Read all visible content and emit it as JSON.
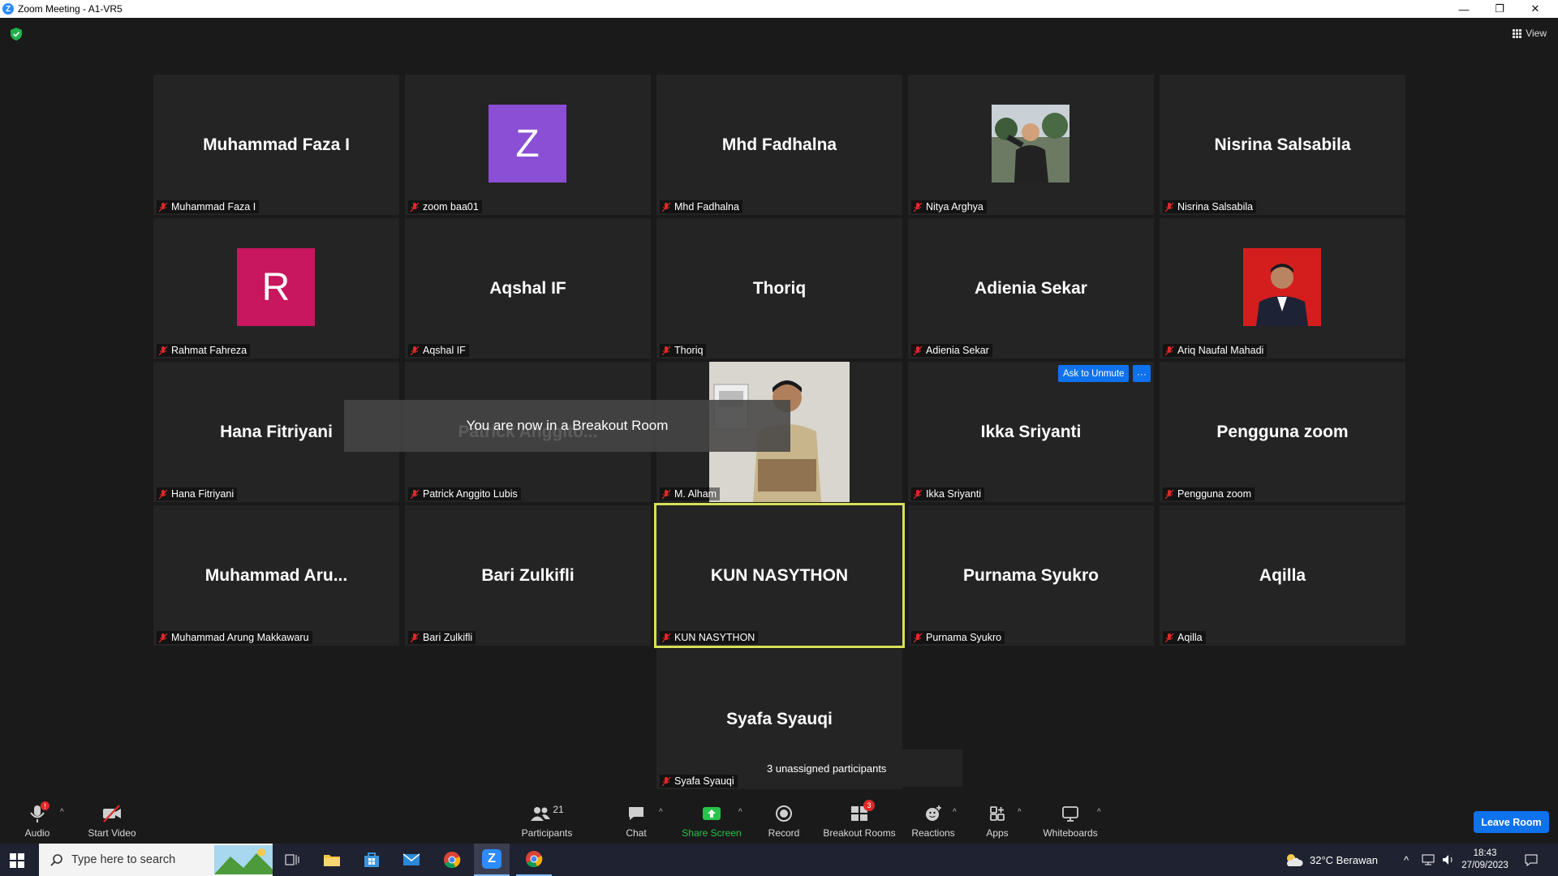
{
  "window": {
    "title": "Zoom Meeting - A1-VR5"
  },
  "view_label": "View",
  "tiles": [
    {
      "name": "Muhammad Faza I",
      "label": "Muhammad Faza I"
    },
    {
      "name": "Z",
      "label": "zoom baa01"
    },
    {
      "name": "Mhd Fadhalna",
      "label": "Mhd Fadhalna"
    },
    {
      "name": "",
      "label": "Nitya Arghya"
    },
    {
      "name": "Nisrina Salsabila",
      "label": "Nisrina Salsabila"
    },
    {
      "name": "R",
      "label": "Rahmat Fahreza"
    },
    {
      "name": "Aqshal IF",
      "label": "Aqshal IF"
    },
    {
      "name": "Thoriq",
      "label": "Thoriq"
    },
    {
      "name": "Adienia Sekar",
      "label": "Adienia Sekar"
    },
    {
      "name": "",
      "label": "Ariq Naufal Mahadi"
    },
    {
      "name": "Hana Fitriyani",
      "label": "Hana Fitriyani"
    },
    {
      "name": "Patrick Anggito...",
      "label": "Patrick Anggito Lubis"
    },
    {
      "name": "",
      "label": "M. Alham"
    },
    {
      "name": "Ikka Sriyanti",
      "label": "Ikka Sriyanti"
    },
    {
      "name": "Pengguna zoom",
      "label": "Pengguna zoom"
    },
    {
      "name": "Muhammad  Aru...",
      "label": "Muhammad Arung Makkawaru"
    },
    {
      "name": "Bari Zulkifli",
      "label": "Bari Zulkifli"
    },
    {
      "name": "KUN NASYTHON",
      "label": "KUN NASYTHON"
    },
    {
      "name": "Purnama Syukro",
      "label": "Purnama Syukro"
    },
    {
      "name": "Aqilla",
      "label": "Aqilla"
    },
    {
      "name": "Syafa Syauqi",
      "label": "Syafa Syauqi"
    }
  ],
  "colors": {
    "avatar_z": "#8a4fd4",
    "avatar_r": "#c8175e",
    "active_border": "#d7e05a",
    "accent": "#0e72ed"
  },
  "toast": "You are now in a Breakout Room",
  "ask_to_unmute": "Ask to Unmute",
  "more_label": "···",
  "unassigned": "3 unassigned participants",
  "toolbar": {
    "audio": "Audio",
    "audio_badge": "!",
    "start_video": "Start Video",
    "participants": "Participants",
    "participants_count": "21",
    "chat": "Chat",
    "share_screen": "Share Screen",
    "record": "Record",
    "breakout_rooms": "Breakout Rooms",
    "breakout_count": "3",
    "reactions": "Reactions",
    "apps": "Apps",
    "whiteboards": "Whiteboards",
    "leave": "Leave Room"
  },
  "taskbar": {
    "search_placeholder": "Type here to search",
    "weather": "32°C  Berawan",
    "time": "18:43",
    "date": "27/09/2023"
  }
}
